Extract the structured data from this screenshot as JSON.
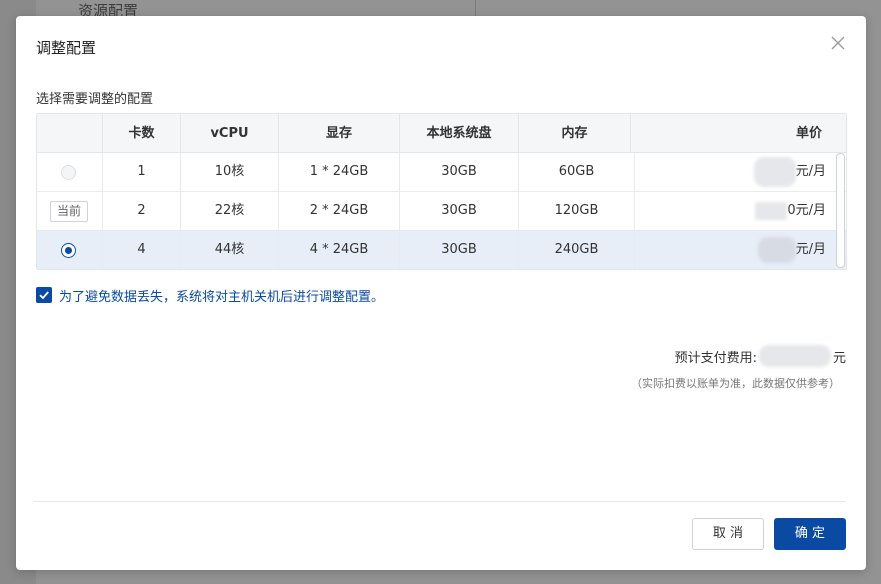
{
  "background": {
    "title": "资源配置"
  },
  "modal": {
    "title": "调整配置",
    "section_label": "选择需要调整的配置"
  },
  "table": {
    "headers": [
      "",
      "卡数",
      "vCPU",
      "显存",
      "本地系统盘",
      "内存",
      "单价"
    ],
    "rows": [
      {
        "status": "disabled",
        "current_tag": "",
        "cards": "1",
        "vcpu": "10核",
        "vram": "1 * 24GB",
        "disk": "30GB",
        "memory": "60GB",
        "price_suffix": "元/月"
      },
      {
        "status": "current",
        "current_tag": "当前",
        "cards": "2",
        "vcpu": "22核",
        "vram": "2 * 24GB",
        "disk": "30GB",
        "memory": "120GB",
        "price_suffix": "0元/月"
      },
      {
        "status": "selected",
        "current_tag": "",
        "cards": "4",
        "vcpu": "44核",
        "vram": "4 * 24GB",
        "disk": "30GB",
        "memory": "240GB",
        "price_suffix": "元/月"
      }
    ]
  },
  "notice": {
    "checked": true,
    "text": "为了避免数据丢失，系统将对主机关机后进行调整配置。"
  },
  "estimate": {
    "label": "预计支付费用:",
    "unit": "元",
    "note": "（实际扣费以账单为准，此数据仅供参考）"
  },
  "buttons": {
    "cancel": "取 消",
    "confirm": "确 定"
  },
  "colors": {
    "accent": "#0b4aa2",
    "selected_row": "#e8eef8"
  }
}
